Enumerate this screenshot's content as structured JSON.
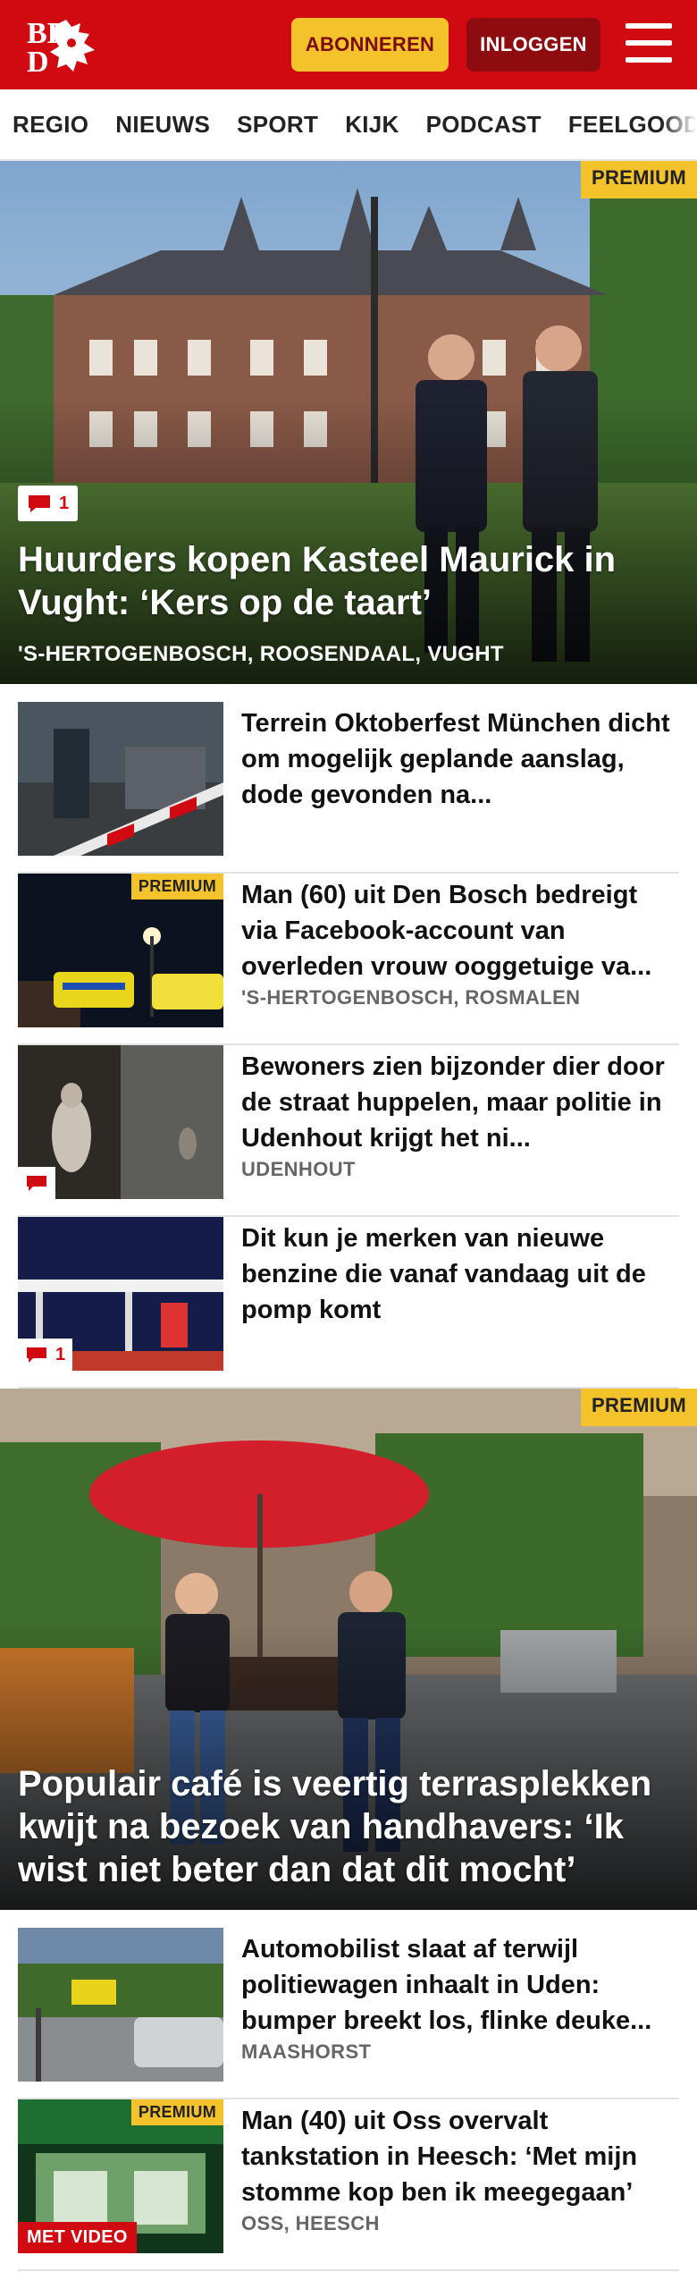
{
  "header": {
    "logo_text": "BD",
    "subscribe_label": "ABONNEREN",
    "login_label": "INLOGGEN"
  },
  "nav": [
    "REGIO",
    "NIEUWS",
    "SPORT",
    "KIJK",
    "PODCAST",
    "FEELGOOD"
  ],
  "hero1": {
    "premium": "PREMIUM",
    "comments": "1",
    "title": "Huurders kopen Kasteel Maurick in Vught: ‘Kers op de taart’",
    "locations": "'S-HERTOGENBOSCH, ROOSENDAAL, VUGHT"
  },
  "articles1": [
    {
      "title": "Terrein Oktoberfest München dicht om mogelijk geplande aanslag, dode gevonden na...",
      "location": ""
    },
    {
      "title": "Man (60) uit Den Bosch bedreigt via Facebook-account van overleden vrouw ooggetuige va...",
      "location": "'S-HERTOGENBOSCH, ROSMALEN",
      "premium": "PREMIUM"
    },
    {
      "title": "Bewoners zien bijzonder dier door de straat huppelen, maar politie in Udenhout krijgt het ni...",
      "location": "UDENHOUT"
    },
    {
      "title": "Dit kun je merken van nieuwe benzine die vanaf vandaag uit de pomp komt",
      "location": "",
      "comments": "1"
    }
  ],
  "hero2": {
    "premium": "PREMIUM",
    "title": "Populair café is veertig terrasplekken kwijt na bezoek van handhavers: ‘Ik wist niet beter dan dat dit mocht’"
  },
  "articles2": [
    {
      "title": "Automobilist slaat af terwijl politiewagen inhaalt in Uden: bumper breekt los, flinke deuke...",
      "location": "MAASHORST"
    },
    {
      "title": "Man (40) uit Oss overvalt tankstation in Heesch: ‘Met mijn stomme kop ben ik meegegaan’",
      "location": "OSS, HEESCH",
      "premium": "PREMIUM",
      "video": "MET VIDEO"
    }
  ],
  "colors": {
    "brand_red": "#d10a11",
    "premium_yellow": "#f4c22b",
    "login_dark_red": "#8e0b10"
  },
  "icons": [
    "bd-logo-icon",
    "hamburger-menu-icon",
    "comment-icon"
  ]
}
